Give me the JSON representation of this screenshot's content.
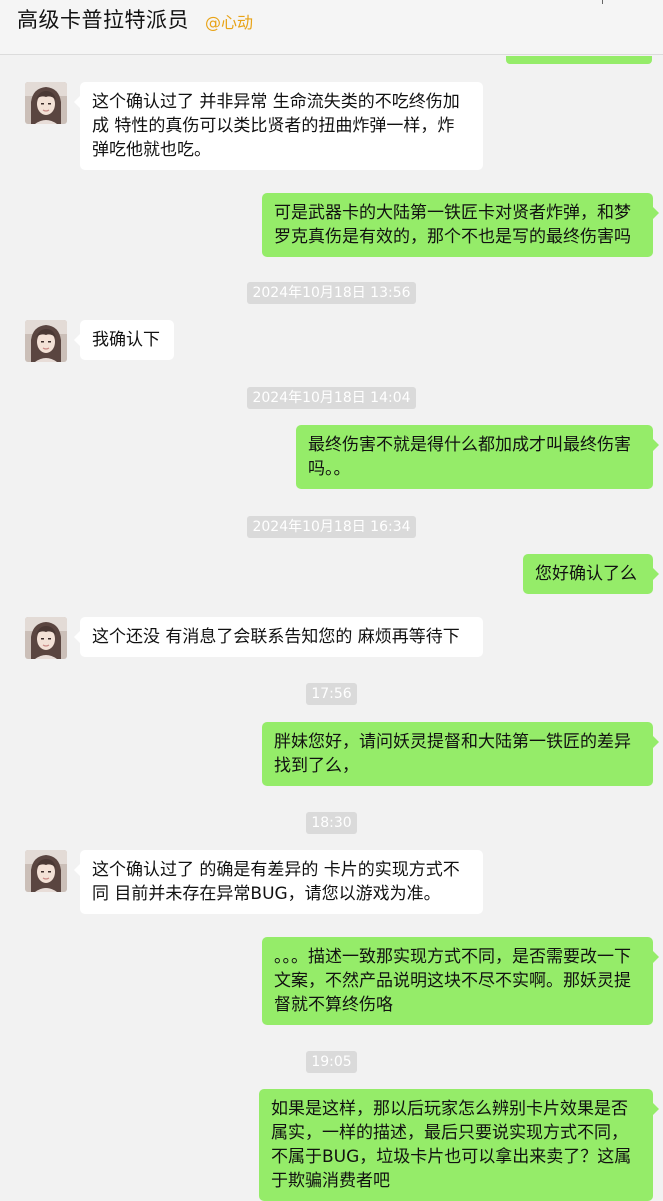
{
  "header": {
    "title": "高级卡普拉特派员",
    "tag": "@心动"
  },
  "messages": [
    {
      "text": "这个确认过了 并非异常 生命流失类的不吃终伤加成  特性的真伤可以类比贤者的扭曲炸弹一样，炸弹吃他就也吃。"
    },
    {
      "text": "可是武器卡的大陆第一铁匠卡对贤者炸弹，和梦罗克真伤是有效的，那个不也是写的最终伤害吗"
    },
    {
      "text": "我确认下"
    },
    {
      "text": "最终伤害不就是得什么都加成才叫最终伤害吗。。"
    },
    {
      "text": "您好确认了么"
    },
    {
      "text": "这个还没 有消息了会联系告知您的 麻烦再等待下"
    },
    {
      "text": "胖妹您好，请问妖灵提督和大陆第一铁匠的差异找到了么，"
    },
    {
      "text": "这个确认过了 的确是有差异的 卡片的实现方式不同 目前并未存在异常BUG，请您以游戏为准。"
    },
    {
      "text": "。。。描述一致那实现方式不同，是否需要改一下文案，不然产品说明这块不尽不实啊。那妖灵提督就不算终伤咯"
    },
    {
      "text": "如果是这样，那以后玩家怎么辨别卡片效果是否属实，一样的描述，最后只要说实现方式不同，不属于BUG，垃圾卡片也可以拿出来卖了？这属于欺骗消费者吧"
    }
  ],
  "timestamps": [
    "2024年10月18日 13:56",
    "2024年10月18日 14:04",
    "2024年10月18日 16:34",
    "17:56",
    "18:30",
    "19:05"
  ],
  "colors": {
    "outgoing_bubble": "#95ec69",
    "incoming_bubble": "#ffffff",
    "tag": "#e8a317",
    "background": "#f2f2f2"
  }
}
